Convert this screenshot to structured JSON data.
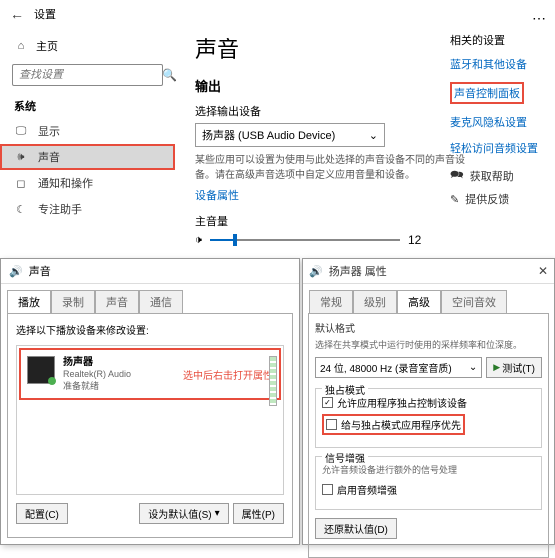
{
  "settings": {
    "header_title": "设置",
    "home": "主页",
    "search_placeholder": "查找设置",
    "category": "系统",
    "nav": {
      "display": "显示",
      "sound": "声音",
      "notifications": "通知和操作",
      "focus": "专注助手"
    }
  },
  "main": {
    "title": "声音",
    "output_h": "输出",
    "choose_label": "选择输出设备",
    "device_selected": "扬声器 (USB Audio Device)",
    "desc1": "某些应用可以设置为使用与此处选择的声音设备不同的声音设备。请在高级声音选项中自定义应用音量和设备。",
    "device_props": "设备属性",
    "volume_h": "主音量",
    "volume_value": "12"
  },
  "related": {
    "heading": "相关的设置",
    "bluetooth": "蓝牙和其他设备",
    "control_panel": "声音控制面板",
    "mic_privacy": "麦克风隐私设置",
    "easy_access": "轻松访问音频设置",
    "get_help": "获取帮助",
    "feedback": "提供反馈"
  },
  "sound_dlg": {
    "title": "声音",
    "tabs": {
      "playback": "播放",
      "recording": "录制",
      "sounds": "声音",
      "comm": "通信"
    },
    "instruction": "选择以下播放设备来修改设置:",
    "device_name": "扬声器",
    "device_sub1": "Realtek(R) Audio",
    "device_sub2": "准备就绪",
    "note": "选中后右击打开属性",
    "configure": "配置(C)",
    "set_default": "设为默认值(S)",
    "properties": "属性(P)"
  },
  "props_dlg": {
    "title": "扬声器 属性",
    "tabs": {
      "general": "常规",
      "levels": "级别",
      "advanced": "高级",
      "spatial": "空间音效"
    },
    "default_fmt": "默认格式",
    "default_desc": "选择在共享模式中运行时使用的采样频率和位深度。",
    "format_value": "24 位, 48000 Hz (录音室音质)",
    "test": "测试(T)",
    "exclusive_h": "独占模式",
    "chk1": "允许应用程序独占控制该设备",
    "chk2": "给与独占模式应用程序优先",
    "signal_h": "信号增强",
    "signal_desc": "允许音频设备进行额外的信号处理",
    "chk3": "启用音频增强",
    "restore": "还原默认值(D)"
  }
}
